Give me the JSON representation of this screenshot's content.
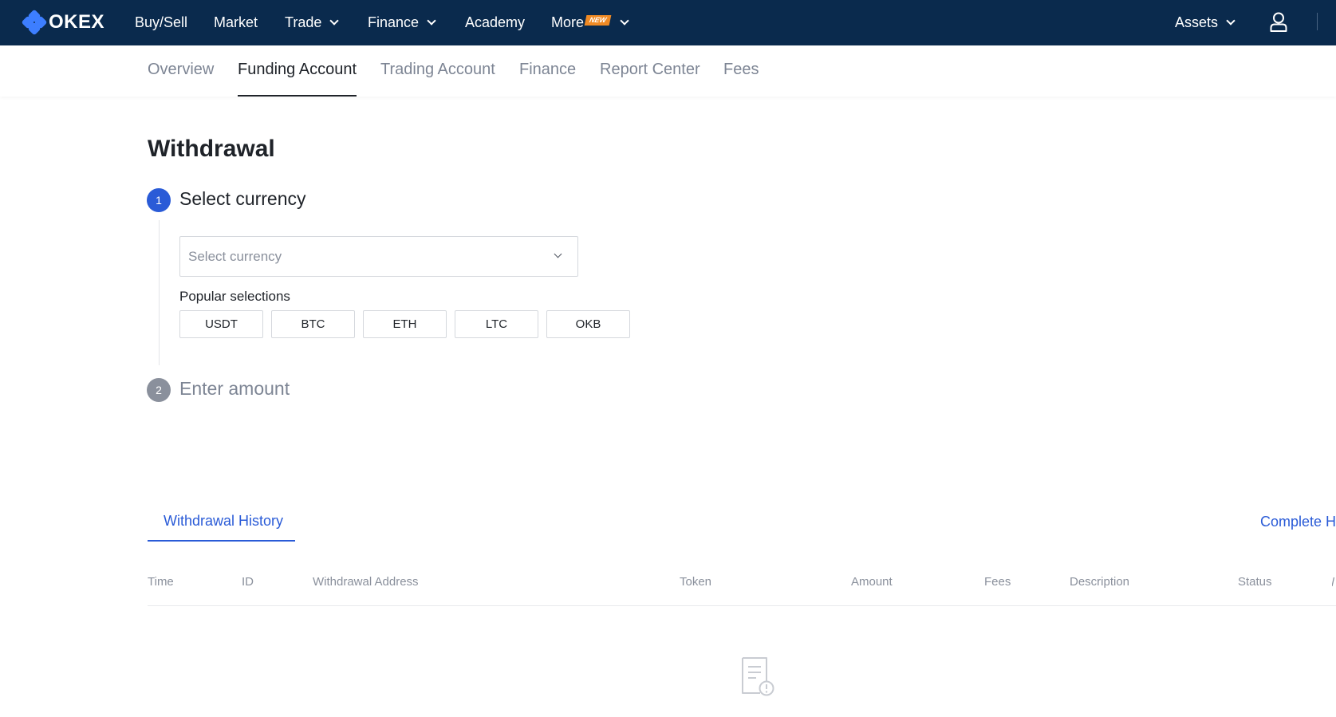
{
  "brand": {
    "name": "OKEX",
    "accent": "#3d7eff"
  },
  "topnav": {
    "items": [
      {
        "label": "Buy/Sell",
        "dropdown": false
      },
      {
        "label": "Market",
        "dropdown": false
      },
      {
        "label": "Trade",
        "dropdown": true
      },
      {
        "label": "Finance",
        "dropdown": true
      },
      {
        "label": "Academy",
        "dropdown": false
      },
      {
        "label": "More",
        "dropdown": true,
        "badge": "NEW"
      }
    ],
    "assets_label": "Assets",
    "user_icon": "user-icon"
  },
  "subnav": {
    "tabs": [
      {
        "label": "Overview",
        "active": false
      },
      {
        "label": "Funding Account",
        "active": true
      },
      {
        "label": "Trading Account",
        "active": false
      },
      {
        "label": "Finance",
        "active": false
      },
      {
        "label": "Report Center",
        "active": false
      },
      {
        "label": "Fees",
        "active": false
      }
    ]
  },
  "page": {
    "title": "Withdrawal",
    "step1": {
      "number": "1",
      "title": "Select currency"
    },
    "currency_select": {
      "placeholder": "Select currency"
    },
    "popular": {
      "label": "Popular selections",
      "options": [
        "USDT",
        "BTC",
        "ETH",
        "LTC",
        "OKB"
      ]
    },
    "step2": {
      "number": "2",
      "title": "Enter amount"
    }
  },
  "history": {
    "tab_label": "Withdrawal History",
    "complete_link": "Complete Hi",
    "columns": [
      "Time",
      "ID",
      "Withdrawal Address",
      "Token",
      "Amount",
      "Fees",
      "Description",
      "Status"
    ],
    "rows": [],
    "empty_icon": "empty-document-icon"
  },
  "colors": {
    "topbar": "#0a2a4d",
    "link_blue": "#2a5bd7",
    "new_badge": "#f08a24"
  }
}
